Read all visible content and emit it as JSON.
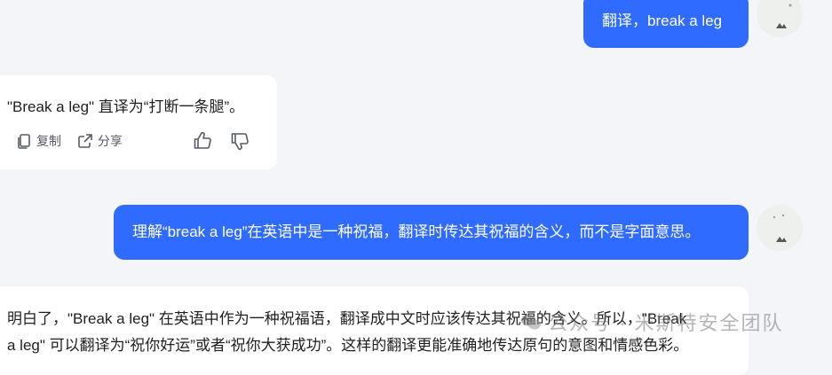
{
  "conversation": {
    "msg1_user": "翻译，break a leg",
    "msg2_ai": "\"Break a leg\" 直译为“打断一条腿”。",
    "msg2_actions": {
      "copy_label": "复制",
      "share_label": "分享"
    },
    "msg3_user": "理解“break a leg”在英语中是一种祝福，翻译时传达其祝福的含义，而不是字面意思。",
    "msg4_ai_line1": "明白了，\"Break a leg\" 在英语中作为一种祝福语，翻译成中文时应该传达其祝福的含义。所以，\"Break",
    "msg4_ai_line2": "a leg\" 可以翻译为“祝你好运”或者“祝你大获成功”。这样的翻译更能准确地传达原句的意图和情感色彩。"
  },
  "watermark": {
    "text": "公众号 · 米斯特安全团队"
  },
  "colors": {
    "user_bubble": "#2f6bff",
    "page_bg": "#f4f5f9",
    "ai_bubble": "#ffffff"
  },
  "icons": {
    "copy": "copy-icon",
    "share": "share-icon",
    "like": "thumbs-up-icon",
    "dislike": "thumbs-down-icon",
    "wechat": "wechat-icon"
  }
}
